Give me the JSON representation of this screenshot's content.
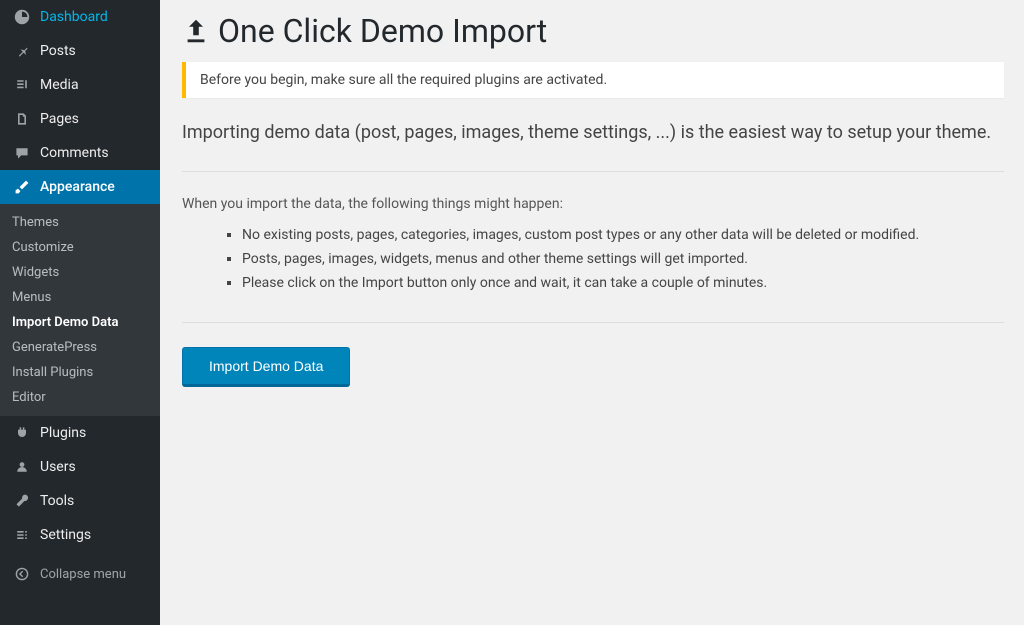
{
  "sidebar": {
    "items": [
      {
        "label": "Dashboard"
      },
      {
        "label": "Posts"
      },
      {
        "label": "Media"
      },
      {
        "label": "Pages"
      },
      {
        "label": "Comments"
      },
      {
        "label": "Appearance"
      },
      {
        "label": "Plugins"
      },
      {
        "label": "Users"
      },
      {
        "label": "Tools"
      },
      {
        "label": "Settings"
      }
    ],
    "appearance_sub": [
      {
        "label": "Themes"
      },
      {
        "label": "Customize"
      },
      {
        "label": "Widgets"
      },
      {
        "label": "Menus"
      },
      {
        "label": "Import Demo Data"
      },
      {
        "label": "GeneratePress"
      },
      {
        "label": "Install Plugins"
      },
      {
        "label": "Editor"
      }
    ],
    "collapse": "Collapse menu"
  },
  "page": {
    "title": "One Click Demo Import",
    "notice": "Before you begin, make sure all the required plugins are activated.",
    "intro": "Importing demo data (post, pages, images, theme settings, ...) is the easiest way to setup your theme.",
    "lead": "When you import the data, the following things might happen:",
    "bullets": [
      "No existing posts, pages, categories, images, custom post types or any other data will be deleted or modified.",
      "Posts, pages, images, widgets, menus and other theme settings will get imported.",
      "Please click on the Import button only once and wait, it can take a couple of minutes."
    ],
    "button": "Import Demo Data"
  }
}
